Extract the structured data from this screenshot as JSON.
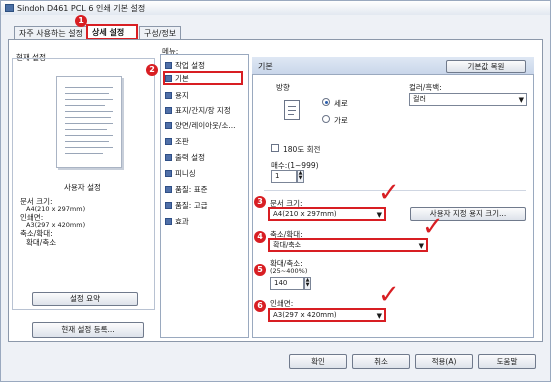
{
  "window": {
    "title": "Sindoh D461 PCL 6 인쇄 기본 설정"
  },
  "tabs": [
    {
      "label": "자주 사용하는 설정"
    },
    {
      "label": "상세 설정"
    },
    {
      "label": "구성/정보"
    }
  ],
  "left": {
    "current_settings_label": "현재 설정",
    "user_settings_label": "사용자 설정",
    "summary_lines": [
      "문서 크기:",
      "A4(210 x 297mm)",
      "인쇄면:",
      "A3(297 x 420mm)",
      "축소/확대:",
      "확대/축소"
    ],
    "summary_button": "설정 요약",
    "register_button": "현재 설정 등록..."
  },
  "menu": {
    "header": "메뉴:",
    "items": [
      "작업 설정",
      "기본",
      "용지",
      "표지/간지/장 지정",
      "양면/레이아웃/소...",
      "조판",
      "출력 설정",
      "피니싱",
      "품질: 표준",
      "품질: 고급",
      "효과"
    ]
  },
  "panel": {
    "title": "기본",
    "restore_button": "기본값 복원",
    "orientation_label": "방향",
    "portrait": "세로",
    "landscape": "가로",
    "color_label": "컬러/흑백:",
    "color_value": "컬러",
    "rotate180": "180도 회전",
    "copies_label": "매수:(1~999)",
    "copies_value": "1",
    "doc_size_label": "문서 크기:",
    "doc_size_value": "A4(210 x 297mm)",
    "custom_size_button": "사용자 지정 용지 크기...",
    "zoom_label": "축소/확대:",
    "zoom_value": "확대/축소",
    "scale_label": "확대/축소:",
    "scale_range": "(25~400%)",
    "scale_value": "140",
    "print_side_label": "인쇄면:",
    "print_side_value": "A3(297 x 420mm)"
  },
  "footer": {
    "ok": "확인",
    "cancel": "취소",
    "apply": "적용(A)",
    "help": "도움말"
  },
  "markers": [
    "1",
    "2",
    "3",
    "4",
    "5",
    "6"
  ],
  "accent_color": "#d81e23"
}
